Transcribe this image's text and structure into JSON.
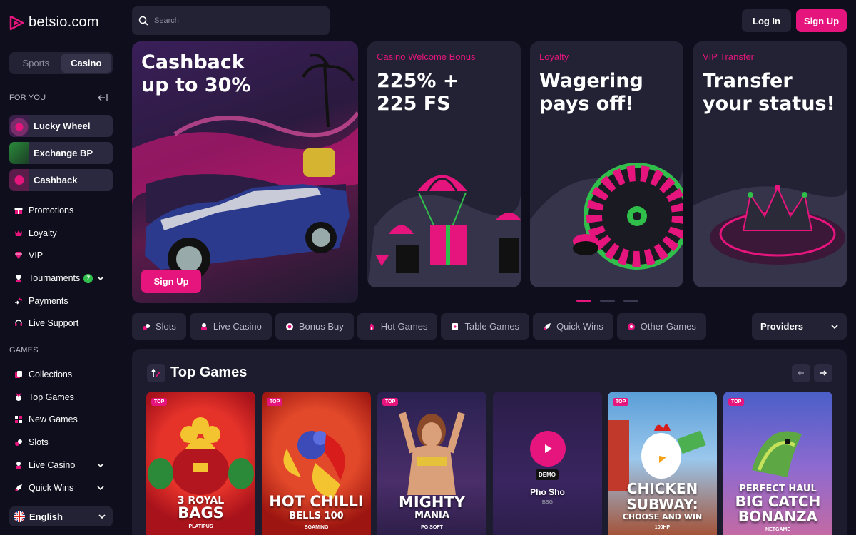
{
  "brand": {
    "name": "betsio.com",
    "accent": "#e6157d"
  },
  "switch": {
    "sports": "Sports",
    "casino": "Casino"
  },
  "sidebar": {
    "for_you_label": "FOR YOU",
    "promo_cards": [
      {
        "label": "Lucky Wheel"
      },
      {
        "label": "Exchange BP"
      },
      {
        "label": "Cashback"
      }
    ],
    "menu": [
      {
        "label": "Promotions",
        "icon": "gift-icon"
      },
      {
        "label": "Loyalty",
        "icon": "crown-icon"
      },
      {
        "label": "VIP",
        "icon": "diamond-icon"
      },
      {
        "label": "Tournaments",
        "icon": "trophy-icon",
        "badge": "7"
      },
      {
        "label": "Payments",
        "icon": "arrows-icon"
      },
      {
        "label": "Live Support",
        "icon": "headset-icon"
      }
    ],
    "games_label": "GAMES",
    "games": [
      {
        "label": "Collections",
        "icon": "collections-icon"
      },
      {
        "label": "Top Games",
        "icon": "top-games-icon"
      },
      {
        "label": "New Games",
        "icon": "new-games-icon"
      },
      {
        "label": "Slots",
        "icon": "slots-icon"
      },
      {
        "label": "Live Casino",
        "icon": "live-casino-icon"
      },
      {
        "label": "Quick Wins",
        "icon": "rocket-icon"
      }
    ],
    "language": "English"
  },
  "header": {
    "search_placeholder": "Search",
    "login": "Log In",
    "signup": "Sign Up"
  },
  "banners": [
    {
      "title_line1": "Cashback",
      "title_line2": "up to 30%",
      "cta": "Sign Up"
    },
    {
      "subtitle": "Casino Welcome Bonus",
      "title_line1": "225% +",
      "title_line2": "225 FS"
    },
    {
      "subtitle": "Loyalty",
      "title_line1": "Wagering",
      "title_line2": "pays off!"
    },
    {
      "subtitle": "VIP Transfer",
      "title_line1": "Transfer",
      "title_line2": "your status!"
    }
  ],
  "categories": [
    {
      "label": "Slots"
    },
    {
      "label": "Live Casino"
    },
    {
      "label": "Bonus Buy"
    },
    {
      "label": "Hot Games"
    },
    {
      "label": "Table Games"
    },
    {
      "label": "Quick Wins"
    },
    {
      "label": "Other Games"
    }
  ],
  "providers_label": "Providers",
  "top_games": {
    "title": "Top Games",
    "tag": "TOP",
    "games": [
      {
        "title1": "3 ROYAL",
        "title2": "BAGS",
        "provider": "PLATIPUS"
      },
      {
        "title1": "HOT CHILLI",
        "title2": "BELLS 100",
        "provider": "BGAMING"
      },
      {
        "title1": "MIGHTY",
        "title2": "MANIA",
        "provider": "PG SOFT"
      },
      {
        "title1": "Pho Sho",
        "title2": "",
        "provider": "BSG",
        "demo": "DEMO"
      },
      {
        "title1": "CHICKEN",
        "title2": "SUBWAY:",
        "title3": "CHOOSE AND WIN",
        "provider": "100HP"
      },
      {
        "title1": "PERFECT HAUL",
        "title2": "BIG CATCH",
        "title3": "BONANZA",
        "provider": "NETGAME"
      }
    ]
  }
}
